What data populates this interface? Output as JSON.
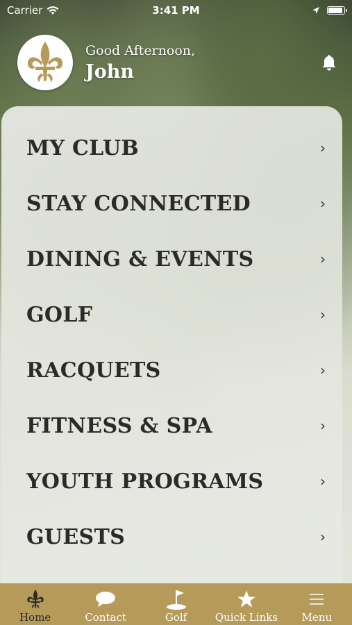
{
  "status_bar": {
    "carrier": "Carrier",
    "time": "3:41 PM"
  },
  "header": {
    "greeting": "Good Afternoon,",
    "name": "John"
  },
  "menu": {
    "items": [
      {
        "label": "MY CLUB"
      },
      {
        "label": "STAY CONNECTED"
      },
      {
        "label": "DINING & EVENTS"
      },
      {
        "label": "GOLF"
      },
      {
        "label": "RACQUETS"
      },
      {
        "label": "FITNESS & SPA"
      },
      {
        "label": "YOUTH PROGRAMS"
      },
      {
        "label": "GUESTS"
      }
    ],
    "chevron": "›"
  },
  "tab_bar": {
    "tabs": [
      {
        "label": "Home",
        "icon": "fleur-de-lis-icon"
      },
      {
        "label": "Contact",
        "icon": "chat-bubble-icon"
      },
      {
        "label": "Golf",
        "icon": "golf-flag-icon"
      },
      {
        "label": "Quick Links",
        "icon": "star-icon"
      },
      {
        "label": "Menu",
        "icon": "hamburger-icon"
      }
    ],
    "active_color": "#2a2a2a",
    "background": "#b59a5a"
  },
  "colors": {
    "accent_gold": "#b59a5a",
    "text_dark": "#2a2a2a"
  }
}
